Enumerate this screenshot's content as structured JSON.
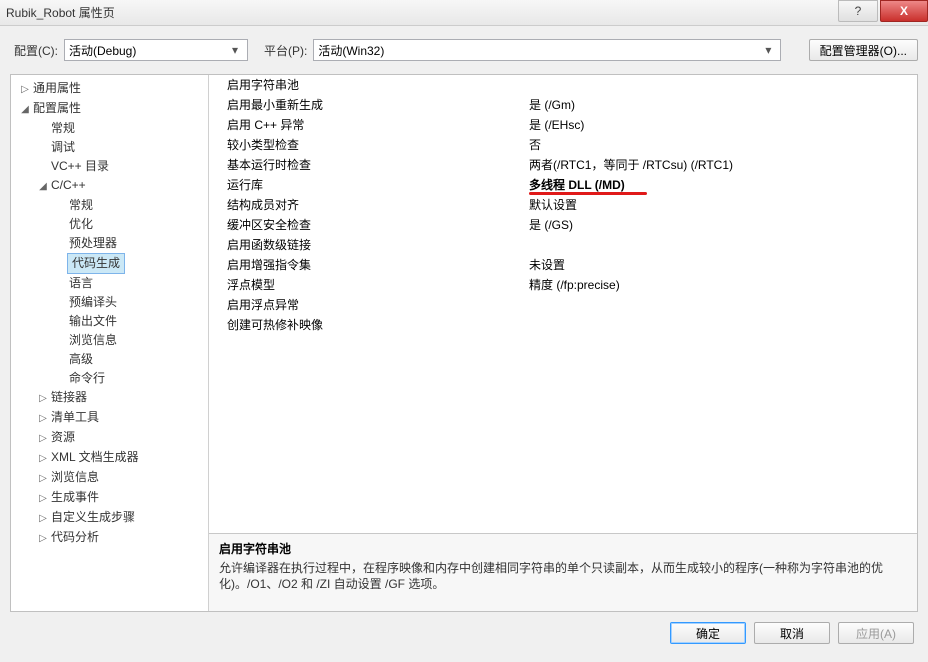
{
  "window": {
    "title": "Rubik_Robot 属性页",
    "help": "?",
    "close": "X"
  },
  "top": {
    "config_label": "配置(C):",
    "config_value": "活动(Debug)",
    "platform_label": "平台(P):",
    "platform_value": "活动(Win32)",
    "manager_button": "配置管理器(O)..."
  },
  "tree": [
    {
      "lvl": 0,
      "tw": "▷",
      "label": "通用属性"
    },
    {
      "lvl": 0,
      "tw": "◢",
      "label": "配置属性"
    },
    {
      "lvl": 1,
      "label": "常规"
    },
    {
      "lvl": 1,
      "label": "调试"
    },
    {
      "lvl": 1,
      "label": "VC++ 目录"
    },
    {
      "lvl": 1,
      "tw": "◢",
      "label": "C/C++"
    },
    {
      "lvl": 2,
      "label": "常规"
    },
    {
      "lvl": 2,
      "label": "优化"
    },
    {
      "lvl": 2,
      "label": "预处理器"
    },
    {
      "lvl": 2,
      "label": "代码生成",
      "selected": true
    },
    {
      "lvl": 2,
      "label": "语言"
    },
    {
      "lvl": 2,
      "label": "预编译头"
    },
    {
      "lvl": 2,
      "label": "输出文件"
    },
    {
      "lvl": 2,
      "label": "浏览信息"
    },
    {
      "lvl": 2,
      "label": "高级"
    },
    {
      "lvl": 2,
      "label": "命令行"
    },
    {
      "lvl": 1,
      "tw": "▷",
      "label": "链接器"
    },
    {
      "lvl": 1,
      "tw": "▷",
      "label": "清单工具"
    },
    {
      "lvl": 1,
      "tw": "▷",
      "label": "资源"
    },
    {
      "lvl": 1,
      "tw": "▷",
      "label": "XML 文档生成器"
    },
    {
      "lvl": 1,
      "tw": "▷",
      "label": "浏览信息"
    },
    {
      "lvl": 1,
      "tw": "▷",
      "label": "生成事件"
    },
    {
      "lvl": 1,
      "tw": "▷",
      "label": "自定义生成步骤"
    },
    {
      "lvl": 1,
      "tw": "▷",
      "label": "代码分析"
    }
  ],
  "grid": [
    {
      "k": "启用字符串池",
      "v": ""
    },
    {
      "k": "启用最小重新生成",
      "v": "是 (/Gm)"
    },
    {
      "k": "启用 C++ 异常",
      "v": "是 (/EHsc)"
    },
    {
      "k": "较小类型检查",
      "v": "否"
    },
    {
      "k": "基本运行时检查",
      "v": "两者(/RTC1，等同于 /RTCsu) (/RTC1)"
    },
    {
      "k": "运行库",
      "v": "多线程 DLL (/MD)",
      "bold": true,
      "redline": true
    },
    {
      "k": "结构成员对齐",
      "v": "默认设置"
    },
    {
      "k": "缓冲区安全检查",
      "v": "是 (/GS)"
    },
    {
      "k": "启用函数级链接",
      "v": ""
    },
    {
      "k": "启用增强指令集",
      "v": "未设置"
    },
    {
      "k": "浮点模型",
      "v": "精度 (/fp:precise)"
    },
    {
      "k": "启用浮点异常",
      "v": ""
    },
    {
      "k": "创建可热修补映像",
      "v": ""
    }
  ],
  "desc": {
    "title": "启用字符串池",
    "body": "允许编译器在执行过程中，在程序映像和内存中创建相同字符串的单个只读副本，从而生成较小的程序(一种称为字符串池的优化)。/O1、/O2 和 /ZI 自动设置 /GF 选项。"
  },
  "buttons": {
    "ok": "确定",
    "cancel": "取消",
    "apply": "应用(A)"
  }
}
